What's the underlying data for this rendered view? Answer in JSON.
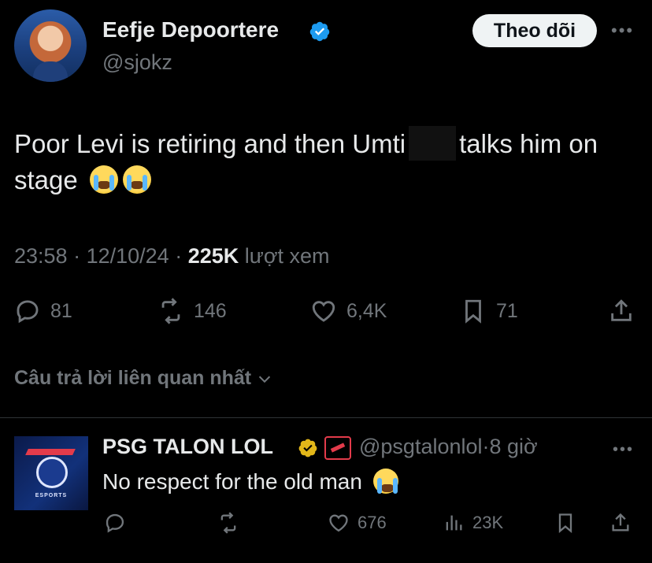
{
  "tweet": {
    "author_name": "Eefje Depoortere",
    "handle": "@sjokz",
    "follow_label": "Theo dõi",
    "text_part1": "Poor Levi is retiring and then Umti",
    "text_part2": "talks him on stage",
    "time": "23:58",
    "date": "12/10/24",
    "views_count": "225K",
    "views_label": "lượt xem",
    "replies": "81",
    "retweets": "146",
    "likes": "6,4K",
    "bookmarks": "71"
  },
  "sort": {
    "label": "Câu trả lời liên quan nhất"
  },
  "reply": {
    "author_name": "PSG TALON LOL",
    "handle": "@psgtalonlol",
    "time_ago": "8 giờ",
    "text": "No respect for the old man",
    "avatar_text": "ESPORTS",
    "replies": "",
    "retweets": "",
    "likes": "676",
    "views": "23K"
  },
  "colors": {
    "background": "#000000",
    "text": "#e7e9ea",
    "muted": "#71767b",
    "verified_blue": "#1d9bf0",
    "verified_gold": "#e2b719"
  }
}
